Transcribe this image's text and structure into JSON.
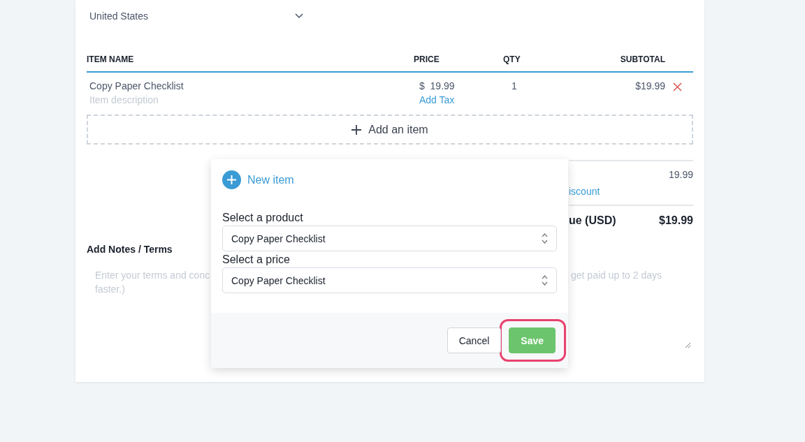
{
  "country": {
    "value": "United States"
  },
  "table": {
    "columns": [
      "ITEM NAME",
      "PRICE",
      "QTY",
      "SUBTOTAL"
    ],
    "rows": [
      {
        "name": "Copy Paper Checklist",
        "description_placeholder": "Item description",
        "currency": "$",
        "price": "19.99",
        "add_tax": "Add Tax",
        "qty": "1",
        "subtotal": "$19.99"
      }
    ]
  },
  "add_item": {
    "label": "Add an item"
  },
  "totals": {
    "subtotal": "19.99",
    "discount_link": "iscount",
    "total_label": "ue (USD)",
    "total": "$19.99"
  },
  "notes": {
    "label": "Add Notes / Terms",
    "placeholder_fragments_left": [
      "Enter your terms and conc",
      "faster.)"
    ],
    "placeholder_fragment_right": "get paid up to 2 days"
  },
  "dialog": {
    "title": "New item",
    "fields": [
      {
        "label": "Select a product",
        "value": "Copy Paper Checklist"
      },
      {
        "label": "Select a price",
        "value": "Copy Paper Checklist"
      }
    ],
    "buttons": [
      {
        "label": "Cancel",
        "kind": "secondary",
        "highlighted": false
      },
      {
        "label": "Save",
        "kind": "primary",
        "highlighted": true
      }
    ]
  }
}
